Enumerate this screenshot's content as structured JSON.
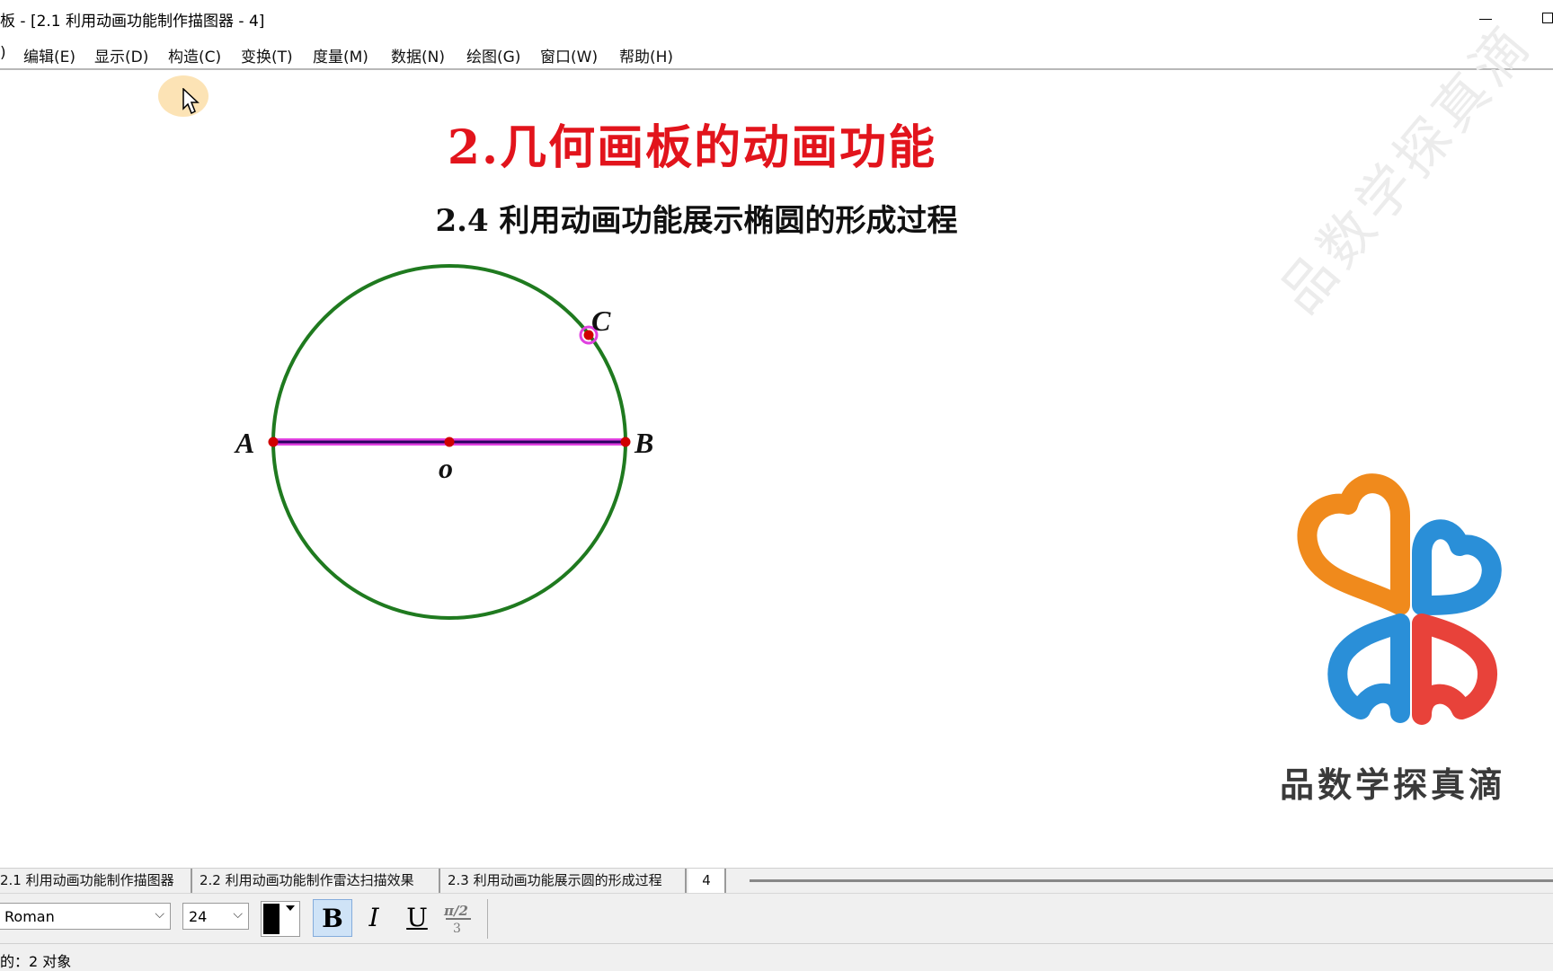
{
  "window": {
    "title": "板 - [2.1 利用动画功能制作描图器 - 4]"
  },
  "menubar": {
    "items": [
      ")",
      "编辑(E)",
      "显示(D)",
      "构造(C)",
      "变换(T)",
      "度量(M)",
      "数据(N)",
      "绘图(G)",
      "窗口(W)",
      "帮助(H)"
    ],
    "hovered": "构造(C)"
  },
  "canvas": {
    "heading": "2.几何画板的动画功能",
    "subheading": "2.4 利用动画功能展示椭圆的形成过程",
    "figure": {
      "points": {
        "A": "A",
        "B": "B",
        "C": "C",
        "O": "o"
      },
      "colors": {
        "circle": "#1f7a1f",
        "segment": "#8e00a8",
        "point": "#d00000",
        "selection": "#e040e0"
      }
    },
    "watermark": "品数学探真滴",
    "brand": "品数学探真滴",
    "colors": {
      "heading": "#e2141c",
      "logo_orange": "#f08a1c",
      "logo_red": "#e8423a",
      "logo_blue": "#2a8fd8"
    }
  },
  "pagetabs": {
    "tabs": [
      "2.1 利用动画功能制作描图器",
      "2.2 利用动画功能制作雷达扫描效果",
      "2.3 利用动画功能展示圆的形成过程",
      "4"
    ],
    "active_index": 3
  },
  "texttoolbar": {
    "font": "Roman",
    "size": "24",
    "bold": "B",
    "italic": "I",
    "underline": "U",
    "math_icon": "math-format-icon",
    "color_value": "#000000"
  },
  "statusbar": {
    "text": "的：2 对象"
  }
}
